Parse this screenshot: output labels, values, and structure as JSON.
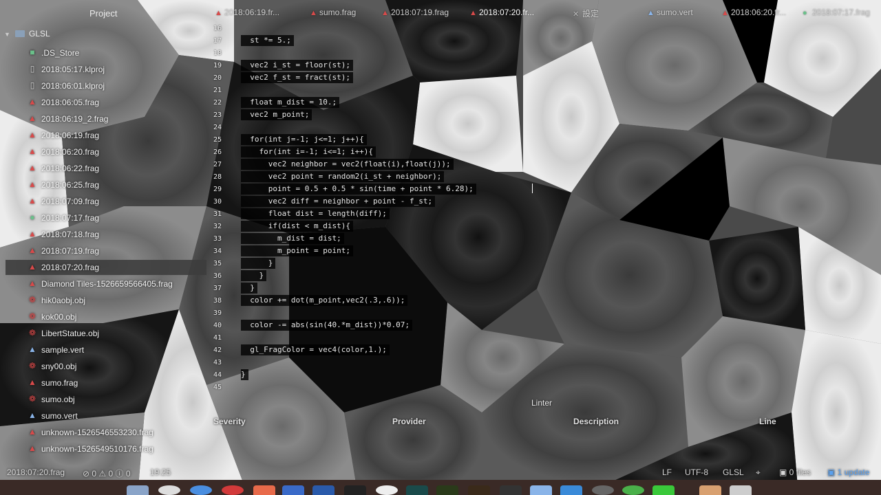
{
  "tabs": [
    {
      "label": "2018:06:19.fr...",
      "icon": "frag-file-icon",
      "active": false
    },
    {
      "label": "sumo.frag",
      "icon": "frag-file-icon",
      "active": false
    },
    {
      "label": "2018:07:19.frag",
      "icon": "frag-file-icon",
      "active": false
    },
    {
      "label": "2018:07:20.fr...",
      "icon": "frag-file-icon",
      "active": true
    },
    {
      "label": "設定",
      "icon": "settings-icon",
      "active": false
    },
    {
      "label": "sumo.vert",
      "icon": "vert-file-icon",
      "active": false
    },
    {
      "label": "2018:06:20.fr...",
      "icon": "frag-file-icon",
      "active": false
    },
    {
      "label": "2018:07:17.frag",
      "icon": "glsl-file-icon",
      "active": false
    }
  ],
  "project": {
    "title": "Project",
    "root": "GLSL"
  },
  "files": [
    {
      "name": ".DS_Store",
      "icon": "ds-store-icon"
    },
    {
      "name": "2018:05:17.klproj",
      "icon": "document-icon"
    },
    {
      "name": "2018:06:01.klproj",
      "icon": "document-icon"
    },
    {
      "name": "2018:06:05.frag",
      "icon": "frag-file-icon"
    },
    {
      "name": "2018:06:19_2.frag",
      "icon": "frag-file-icon"
    },
    {
      "name": "2018:06:19.frag",
      "icon": "frag-file-icon"
    },
    {
      "name": "2018:06:20.frag",
      "icon": "frag-file-icon"
    },
    {
      "name": "2018:06:22.frag",
      "icon": "frag-file-icon"
    },
    {
      "name": "2018:06:25.frag",
      "icon": "frag-file-icon"
    },
    {
      "name": "2018:07:09.frag",
      "icon": "frag-file-icon"
    },
    {
      "name": "2018:07:17.frag",
      "icon": "glsl-file-icon"
    },
    {
      "name": "2018:07:18.frag",
      "icon": "frag-file-icon"
    },
    {
      "name": "2018:07:19.frag",
      "icon": "frag-file-icon"
    },
    {
      "name": "2018:07:20.frag",
      "icon": "frag-file-icon",
      "selected": true
    },
    {
      "name": "Diamond Tiles-1526659566405.frag",
      "icon": "frag-file-icon"
    },
    {
      "name": "hik0aobj.obj",
      "icon": "obj-file-icon"
    },
    {
      "name": "kok00.obj",
      "icon": "obj-file-icon"
    },
    {
      "name": "LibertStatue.obj",
      "icon": "obj-file-icon"
    },
    {
      "name": "sample.vert",
      "icon": "vert-file-icon"
    },
    {
      "name": "sny00.obj",
      "icon": "obj-file-icon"
    },
    {
      "name": "sumo.frag",
      "icon": "frag-file-icon"
    },
    {
      "name": "sumo.obj",
      "icon": "obj-file-icon"
    },
    {
      "name": "sumo.vert",
      "icon": "vert-file-icon"
    },
    {
      "name": "unknown-1526546553230.frag",
      "icon": "frag-file-icon"
    },
    {
      "name": "unknown-1526549510176.frag",
      "icon": "frag-file-icon"
    }
  ],
  "code_lines": [
    {
      "n": "16",
      "text": ""
    },
    {
      "n": "17",
      "text": "  st *= 5.;"
    },
    {
      "n": "18",
      "text": ""
    },
    {
      "n": "19",
      "text": "  vec2 i_st = floor(st);"
    },
    {
      "n": "20",
      "text": "  vec2 f_st = fract(st);"
    },
    {
      "n": "21",
      "text": ""
    },
    {
      "n": "22",
      "text": "  float m_dist = 10.;"
    },
    {
      "n": "23",
      "text": "  vec2 m_point;"
    },
    {
      "n": "24",
      "text": ""
    },
    {
      "n": "25",
      "text": "  for(int j=-1; j<=1; j++){"
    },
    {
      "n": "26",
      "text": "    for(int i=-1; i<=1; i++){"
    },
    {
      "n": "27",
      "text": "      vec2 neighbor = vec2(float(i),float(j));"
    },
    {
      "n": "28",
      "text": "      vec2 point = random2(i_st + neighbor);"
    },
    {
      "n": "29",
      "text": "      point = 0.5 + 0.5 * sin(time + point * 6.28);"
    },
    {
      "n": "30",
      "text": "      vec2 diff = neighbor + point - f_st;"
    },
    {
      "n": "31",
      "text": "      float dist = length(diff);"
    },
    {
      "n": "32",
      "text": "      if(dist < m_dist){"
    },
    {
      "n": "33",
      "text": "        m_dist = dist;"
    },
    {
      "n": "34",
      "text": "        m_point = point;"
    },
    {
      "n": "35",
      "text": "      }"
    },
    {
      "n": "36",
      "text": "    }"
    },
    {
      "n": "37",
      "text": "  }"
    },
    {
      "n": "38",
      "text": "  color += dot(m_point,vec2(.3,.6));"
    },
    {
      "n": "39",
      "text": ""
    },
    {
      "n": "40",
      "text": "  color -= abs(sin(40.*m_dist))*0.07;"
    },
    {
      "n": "41",
      "text": ""
    },
    {
      "n": "42",
      "text": "  gl_FragColor = vec4(color,1.);"
    },
    {
      "n": "43",
      "text": ""
    },
    {
      "n": "44",
      "text": "}"
    },
    {
      "n": "45",
      "text": ""
    }
  ],
  "linter": {
    "title": "Linter",
    "columns": [
      "Severity",
      "Provider",
      "Description",
      "Line"
    ]
  },
  "status": {
    "file": "2018:07:20.frag",
    "counts": "⊘ 0 ⚠ 0 ⓘ 0",
    "cursor": "19:25",
    "eol": "LF",
    "encoding": "UTF-8",
    "grammar": "GLSL",
    "files": "0 files",
    "update": "1 update"
  },
  "colors": {
    "accent": "#5aa0ee",
    "frag_icon": "#d84a4a",
    "vert_icon": "#8ab4e8",
    "obj_icon": "#d84a4a"
  }
}
